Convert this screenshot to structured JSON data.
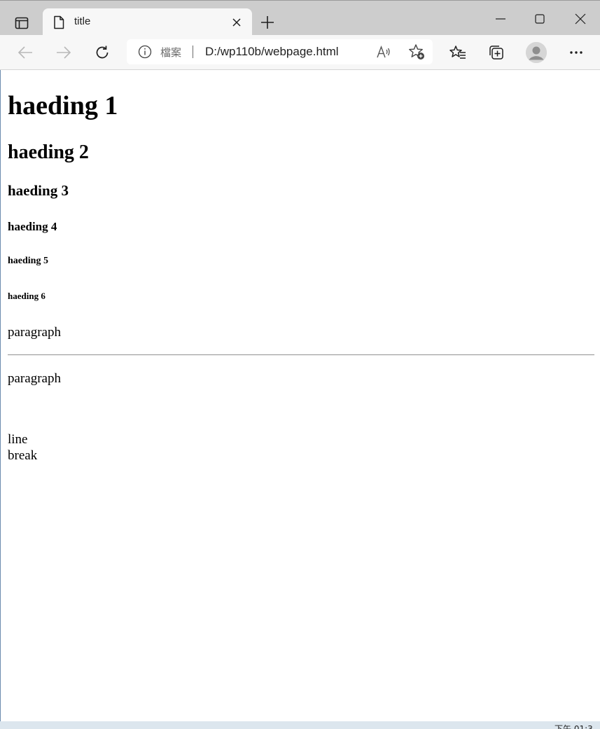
{
  "browser": {
    "tab": {
      "title": "title"
    },
    "address": {
      "scheme_label": "檔案",
      "url": "D:/wp110b/webpage.html"
    },
    "icons": {
      "tab_actions": "tab-actions-icon",
      "page": "page-icon",
      "close": "close-icon",
      "new_tab": "plus-icon",
      "back": "back-arrow-icon",
      "forward": "forward-arrow-icon",
      "refresh": "refresh-icon",
      "info": "info-icon",
      "read_aloud": "read-aloud-icon",
      "add_favorite": "star-add-icon",
      "favorites": "favorites-icon",
      "collections": "collections-icon",
      "profile": "profile-avatar-icon",
      "more": "more-icon"
    }
  },
  "page": {
    "h1": "haeding 1",
    "h2": "haeding 2",
    "h3": "haeding 3",
    "h4": "haeding 4",
    "h5": "haeding 5",
    "h6": "haeding 6",
    "paragraph1": "paragraph",
    "paragraph2": "paragraph",
    "line_break": {
      "line1": "line",
      "line2": "break"
    }
  },
  "taskbar": {
    "clock": "下午 01:3"
  },
  "colors": {
    "tabbar_bg": "#cdcdcd",
    "toolbar_bg": "#f7f7f7",
    "hr": "#9e9e9e"
  }
}
